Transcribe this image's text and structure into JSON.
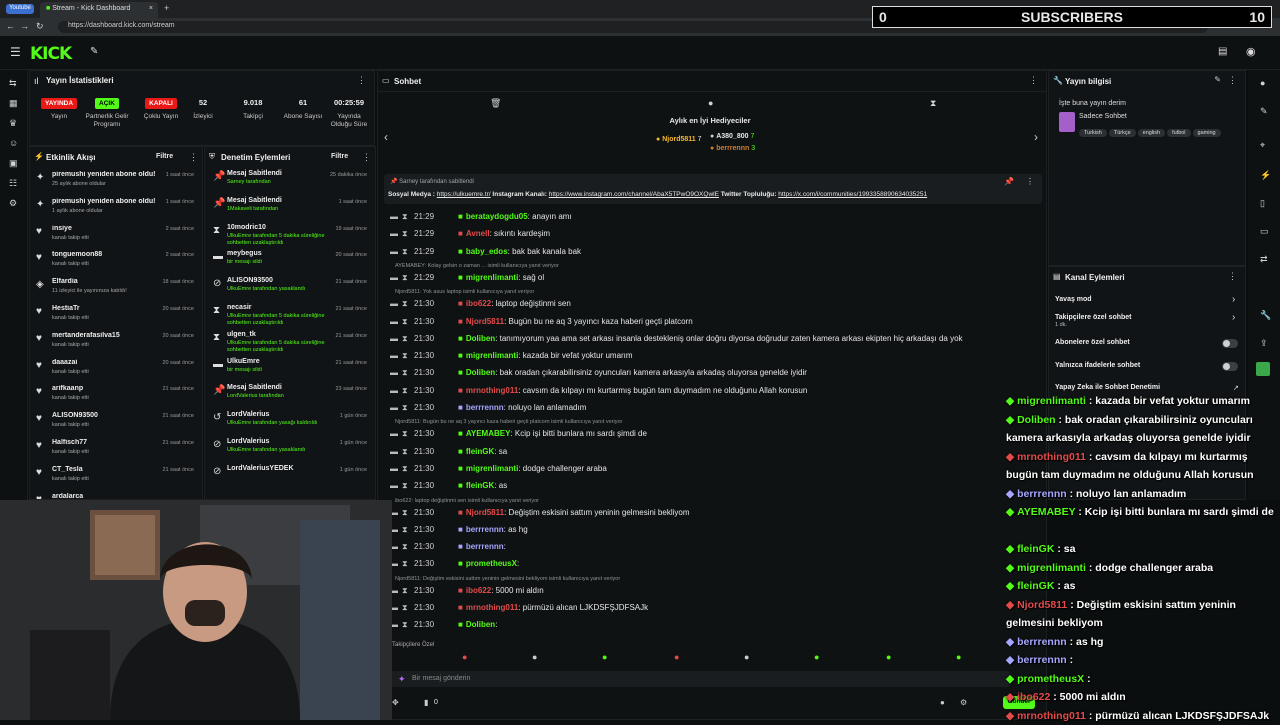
{
  "browser": {
    "tab_profile": "Youtube",
    "tab_title": "Stream - Kick Dashboard",
    "url": "https://dashboard.kick.com/stream"
  },
  "subscriber_overlay": {
    "count": "0",
    "label": "SUBSCRIBERS",
    "goal": "10"
  },
  "logo": "KICK",
  "stats_panel": {
    "title": "Yayın İstatistikleri",
    "items": [
      {
        "badge": "YAYINDA",
        "label": "Yayın",
        "color": "#e91916"
      },
      {
        "badge": "AÇIK",
        "label": "Partnerlik Gelir Programı",
        "color": "#53fc18"
      },
      {
        "badge": "KAPALI",
        "label": "Çoklu Yayın",
        "color": "#e91916"
      },
      {
        "value": "52",
        "label": "İzleyici"
      },
      {
        "value": "9.018",
        "label": "Takipçi"
      },
      {
        "value": "61",
        "label": "Abone Sayısı"
      },
      {
        "value": "00:25:59",
        "label": "Yayında Olduğu Süre"
      }
    ]
  },
  "activity_feed": {
    "title": "Etkinlik Akışı",
    "filter": "Filtre",
    "rows": [
      {
        "icon": "star-icon",
        "title": "piremushi yeniden abone oldu!",
        "sub": "25 aylık abone oldular",
        "ago": "1 saat önce"
      },
      {
        "icon": "star-icon",
        "title": "piremushi yeniden abone oldu!",
        "sub": "1 aylık abone oldular",
        "ago": "1 saat önce"
      },
      {
        "icon": "heart-icon",
        "title": "insiye",
        "sub": "kanalı takip etti",
        "ago": "2 saat önce"
      },
      {
        "icon": "heart-icon",
        "title": "tonguemoon88",
        "sub": "kanalı takip etti",
        "ago": "2 saat önce"
      },
      {
        "icon": "raid-icon",
        "title": "Elfardia",
        "sub": "11 izleyici ile yayınınıza katıldı!",
        "ago": "18 saat önce"
      },
      {
        "icon": "heart-icon",
        "title": "HestiaTr",
        "sub": "kanalı takip etti",
        "ago": "20 saat önce"
      },
      {
        "icon": "heart-icon",
        "title": "mertanderafasilva15",
        "sub": "kanalı takip etti",
        "ago": "20 saat önce"
      },
      {
        "icon": "heart-icon",
        "title": "daaazai",
        "sub": "kanalı takip etti",
        "ago": "20 saat önce"
      },
      {
        "icon": "heart-icon",
        "title": "arifkaanp",
        "sub": "kanalı takip etti",
        "ago": "21 saat önce"
      },
      {
        "icon": "heart-icon",
        "title": "ALISON93500",
        "sub": "kanalı takip etti",
        "ago": "21 saat önce"
      },
      {
        "icon": "heart-icon",
        "title": "Halfisch77",
        "sub": "kanalı takip etti",
        "ago": "21 saat önce"
      },
      {
        "icon": "heart-icon",
        "title": "CT_Tesla",
        "sub": "kanalı takip etti",
        "ago": "21 saat önce"
      },
      {
        "icon": "heart-icon",
        "title": "ardalarca",
        "sub": "",
        "ago": ""
      }
    ]
  },
  "mod_actions": {
    "title": "Denetim Eylemleri",
    "filter": "Filtre",
    "rows": [
      {
        "icon": "pin-icon",
        "title": "Mesaj Sabitlendi",
        "sub": "Sarney tarafından",
        "ago": "25 dakika önce"
      },
      {
        "icon": "pin-icon",
        "title": "Mesaj Sabitlendi",
        "sub": "1Makaveli tarafından",
        "ago": "1 saat önce"
      },
      {
        "icon": "hourglass-icon",
        "title": "10modric10",
        "sub": "UlkuEmre tarafından 5 dakika süreliğine sohbetten uzaklaştırıldı",
        "ago": "19 saat önce"
      },
      {
        "icon": "trash-icon",
        "title": "meybegus",
        "sub": "bir mesajı sildi",
        "ago": "20 saat önce"
      },
      {
        "icon": "ban-icon",
        "title": "ALISON93500",
        "sub": "UlkuEmre tarafından yasaklandı",
        "ago": "21 saat önce"
      },
      {
        "icon": "hourglass-icon",
        "title": "necasir",
        "sub": "UlkuEmre tarafından 5 dakika süreliğine sohbetten uzaklaştırıldı",
        "ago": "21 saat önce"
      },
      {
        "icon": "hourglass-icon",
        "title": "ulgen_tk",
        "sub": "UlkuEmre tarafından 5 dakika süreliğine sohbetten uzaklaştırıldı",
        "ago": "21 saat önce"
      },
      {
        "icon": "trash-icon",
        "title": "UlkuEmre",
        "sub": "bir mesajı sildi",
        "ago": "21 saat önce"
      },
      {
        "icon": "pin-icon",
        "title": "Mesaj Sabitlendi",
        "sub": "LordValerius tarafından",
        "ago": "23 saat önce"
      },
      {
        "icon": "undo-icon",
        "title": "LordValerius",
        "sub": "UlkuEmre tarafından yasağı kaldırıldı",
        "ago": "1 gün önce"
      },
      {
        "icon": "ban-icon",
        "title": "LordValerius",
        "sub": "UlkuEmre tarafından yasaklandı",
        "ago": "1 gün önce"
      },
      {
        "icon": "ban-icon",
        "title": "LordValeriusYEDEK",
        "sub": "",
        "ago": "1 gün önce"
      }
    ]
  },
  "chat": {
    "title": "Sohbet",
    "top_gifters_title": "Aylık en İyi Hediyeciler",
    "gifters": [
      {
        "name": "Njord5811",
        "count": "7"
      },
      {
        "name": "A380_800",
        "count": "7"
      },
      {
        "name": "berrrennn",
        "count": "3"
      }
    ],
    "pinned_by": "Sarney tarafından sabitlendi",
    "pinned_text_prefix": "Sosyal Medya : ",
    "pinned_link1": "https://ulkuemre.tr/",
    "pinned_mid": " Instagram Kanalı: ",
    "pinned_link2": "https://www.instagram.com/channel/AbaX5TPwO9OXQwlE",
    "pinned_mid2": " Twitter Topluluğu: ",
    "pinned_link3": "https://x.com/i/communities/1993358890634035251",
    "messages": [
      {
        "time": "21:29",
        "user": "berataydogdu05",
        "color": "#53fc18",
        "text": ": anayın amı"
      },
      {
        "time": "21:29",
        "user": "Avnell",
        "color": "#e34b4b",
        "text": ": sıkıntı kardeşim"
      },
      {
        "time": "21:29",
        "user": "baby_edos",
        "color": "#53fc18",
        "text": ": bak bak kanala bak"
      },
      {
        "reply": "AYEMABEY: Kolay gelsin o zaman ... isimli kullanıcıya yanıt veriyor"
      },
      {
        "time": "21:29",
        "user": "migrenlimanti",
        "color": "#53fc18",
        "text": ": sağ ol"
      },
      {
        "reply": "Njord5811: Yok asus laptop isimli kullanıcıya yanıt veriyor"
      },
      {
        "time": "21:30",
        "user": "ibo622",
        "color": "#e34b4b",
        "text": ": laptop değiştinmi sen"
      },
      {
        "time": "21:30",
        "user": "Njord5811",
        "color": "#e34b4b",
        "text": ": Bugün bu ne aq 3 yayıncı kaza haberi geçti platcorn"
      },
      {
        "time": "21:30",
        "user": "Doliben",
        "color": "#53fc18",
        "text": ": tanımıyorum yaa ama set arkası insanla destekleniş onlar doğru diyorsa doğrudur zaten kamera arkası ekipten hiç arkadaşı da yok"
      },
      {
        "time": "21:30",
        "user": "migrenlimanti",
        "color": "#53fc18",
        "text": ": kazada bir vefat yoktur umarım"
      },
      {
        "time": "21:30",
        "user": "Doliben",
        "color": "#53fc18",
        "text": ": bak oradan çıkarabilirsiniz oyuncuları kamera arkasıyla arkadaş oluyorsa genelde iyidir"
      },
      {
        "time": "21:30",
        "user": "mrnothing011",
        "color": "#e34b4b",
        "text": ": cavsım da kılpayı mı kurtarmış bugün tam duymadım ne olduğunu Allah korusun"
      },
      {
        "time": "21:30",
        "user": "berrrennn",
        "color": "#a6a6ff",
        "text": ": noluyo lan anlamadım"
      },
      {
        "reply": "Njord5811: Bugün bu ne aq 3 yayıncı kaza haberi geçti platcorn isimli kullanıcıya yanıt veriyor"
      },
      {
        "time": "21:30",
        "user": "AYEMABEY",
        "color": "#53fc18",
        "text": ": Kcip işi bitti bunlara mı sardı şimdi de"
      },
      {
        "time": "21:30",
        "user": "fleinGK",
        "color": "#53fc18",
        "text": ": sa"
      },
      {
        "time": "21:30",
        "user": "migrenlimanti",
        "color": "#53fc18",
        "text": ": dodge challenger araba"
      },
      {
        "time": "21:30",
        "user": "fleinGK",
        "color": "#53fc18",
        "text": ": as"
      },
      {
        "reply": "ibo622: laptop değiştinmi sen isimli kullanıcıya yanıt veriyor"
      },
      {
        "time": "21:30",
        "user": "Njord5811",
        "color": "#e34b4b",
        "text": ": Değiştim eskisini sattım yeninin gelmesini bekliyom"
      },
      {
        "time": "21:30",
        "user": "berrrennn",
        "color": "#a6a6ff",
        "text": ": as hg"
      },
      {
        "time": "21:30",
        "user": "berrrennn",
        "color": "#a6a6ff",
        "text": ":"
      },
      {
        "time": "21:30",
        "user": "prometheusX",
        "color": "#53fc18",
        "text": ":"
      },
      {
        "reply": "Njord5811: Değiştim eskisini sattım yeninin gelmesini bekliyom isimli kullanıcıya yanıt veriyor"
      },
      {
        "time": "21:30",
        "user": "ibo622",
        "color": "#e34b4b",
        "text": ": 5000 mi aldın"
      },
      {
        "time": "21:30",
        "user": "mrnothing011",
        "color": "#e34b4b",
        "text": ": pürmüzü alıcan LJKDSFŞJDFSAJk"
      },
      {
        "time": "21:30",
        "user": "Doliben",
        "color": "#53fc18",
        "text": ":"
      }
    ],
    "followers_only": "Takipçilere Özel",
    "input_placeholder": "Bir mesaj gönderin",
    "char_count": "0",
    "send_label": "Gönder"
  },
  "stream_info": {
    "title": "Yayın bilgisi",
    "stream_title": "İşte buna yayın derim",
    "category": "Sadece Sohbet",
    "tags": [
      "Turkish",
      "Türkçe",
      "english",
      "futbol",
      "gaming"
    ]
  },
  "channel_actions": {
    "title": "Kanal Eylemleri",
    "items": [
      {
        "label": "Yavaş mod",
        "type": "arrow"
      },
      {
        "label": "Takipçilere özel sohbet",
        "sub": "1 dk.",
        "type": "arrow"
      },
      {
        "label": "Abonelere özel sohbet",
        "type": "toggle"
      },
      {
        "label": "Yalnızca ifadelerle sohbet",
        "type": "toggle"
      },
      {
        "label": "Yapay Zeka ile Sohbet Denetimi",
        "type": "link"
      }
    ]
  },
  "overlay_chat": [
    {
      "user": "migrenlimanti",
      "color": "#53fc18",
      "text": " : kazada bir vefat yoktur umarım"
    },
    {
      "user": "Doliben",
      "color": "#53fc18",
      "text": " : bak oradan çıkarabilirsiniz oyuncuları kamera arkasıyla arkadaş oluyorsa genelde iyidir"
    },
    {
      "user": "mrnothing011",
      "color": "#e34b4b",
      "text": " : cavsım da kılpayı mı kurtarmış bugün tam duymadım ne olduğunu Allah korusun"
    },
    {
      "user": "berrrennn",
      "color": "#a6a6ff",
      "text": " : noluyo lan anlamadım"
    },
    {
      "user": "AYEMABEY",
      "color": "#53fc18",
      "text": " : Kcip işi bitti bunlara mı sardı şimdi de"
    },
    {
      "user": "fleinGK",
      "color": "#53fc18",
      "text": " : sa"
    },
    {
      "user": "migrenlimanti",
      "color": "#53fc18",
      "text": " : dodge challenger araba"
    },
    {
      "user": "fleinGK",
      "color": "#53fc18",
      "text": " : as"
    },
    {
      "user": "Njord5811",
      "color": "#e34b4b",
      "text": " : Değiştim eskisini sattım yeninin gelmesini bekliyom"
    },
    {
      "user": "berrrennn",
      "color": "#a6a6ff",
      "text": " : as hg"
    },
    {
      "user": "berrrennn",
      "color": "#a6a6ff",
      "text": " :"
    },
    {
      "user": "prometheusX",
      "color": "#53fc18",
      "text": " :"
    },
    {
      "user": "ibo622",
      "color": "#e34b4b",
      "text": " : 5000 mi aldın"
    },
    {
      "user": "mrnothing011",
      "color": "#e34b4b",
      "text": " : pürmüzü alıcan LJKDSFŞJDFSAJk"
    }
  ],
  "colors": {
    "brand": "#53fc18",
    "live": "#e91916",
    "bg": "#0b0e0f"
  }
}
